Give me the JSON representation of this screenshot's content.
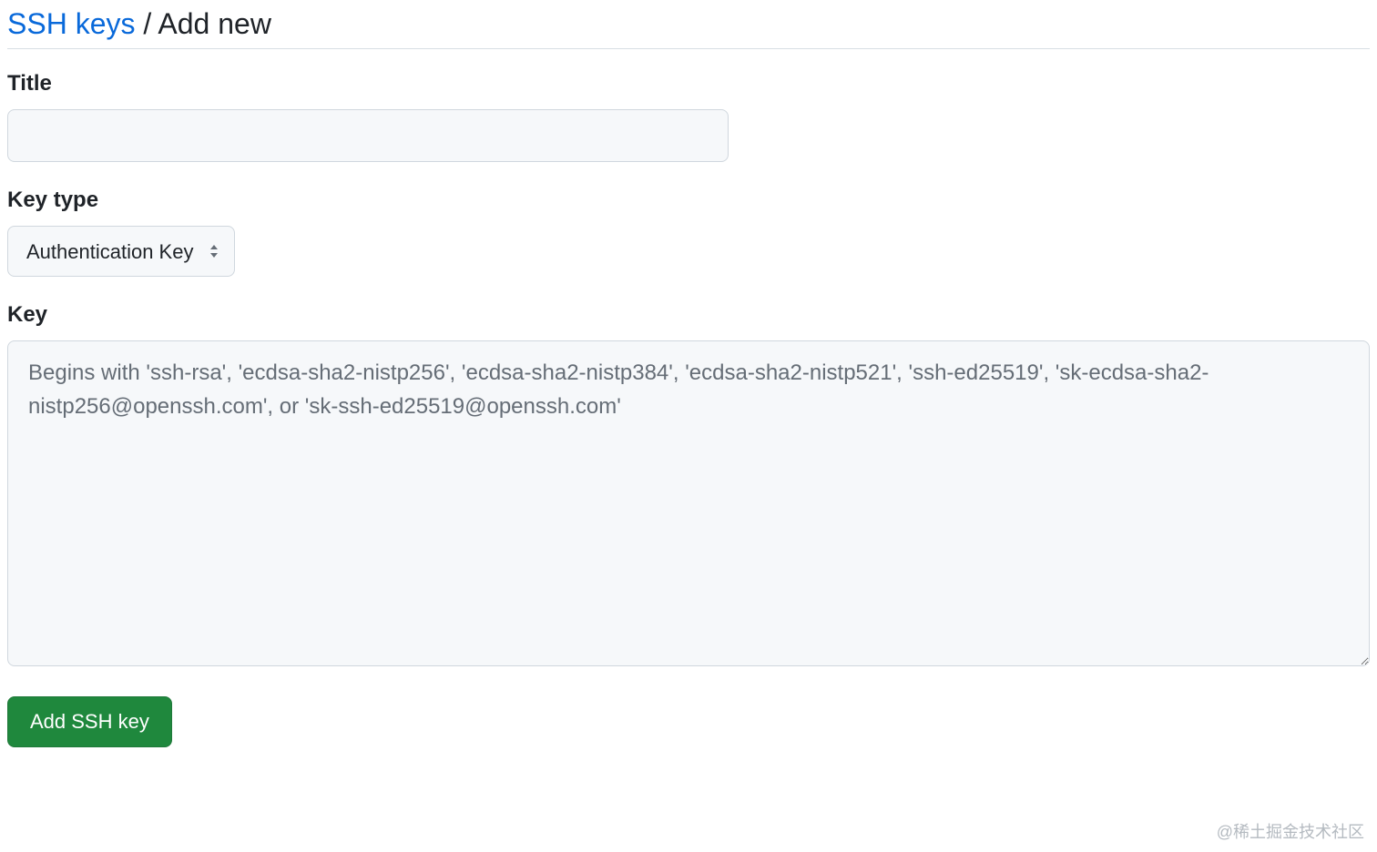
{
  "breadcrumb": {
    "link_text": "SSH keys",
    "separator": " / ",
    "current": "Add new"
  },
  "form": {
    "title": {
      "label": "Title",
      "value": ""
    },
    "key_type": {
      "label": "Key type",
      "selected": "Authentication Key"
    },
    "key": {
      "label": "Key",
      "value": "",
      "placeholder": "Begins with 'ssh-rsa', 'ecdsa-sha2-nistp256', 'ecdsa-sha2-nistp384', 'ecdsa-sha2-nistp521', 'ssh-ed25519', 'sk-ecdsa-sha2-nistp256@openssh.com', or 'sk-ssh-ed25519@openssh.com'"
    },
    "submit_label": "Add SSH key"
  },
  "watermark": "@稀土掘金技术社区"
}
